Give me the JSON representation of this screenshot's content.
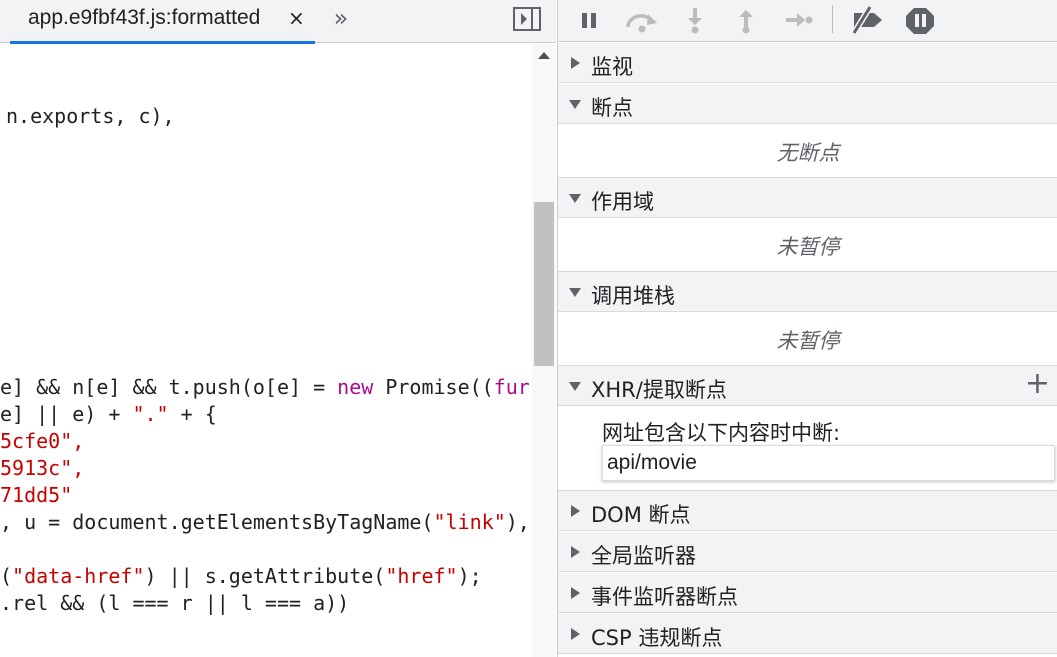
{
  "editor": {
    "tab_label": "app.e9fbf43f.js:formatted",
    "tab_close": "×",
    "more_tabs": "»",
    "code_lines": [
      [
        {
          "t": "n.exports, c),",
          "c": "plain"
        }
      ],
      [
        {
          "t": "e] && n[e] && t.push(o[e] = ",
          "c": "plain"
        },
        {
          "t": "new",
          "c": "kw"
        },
        {
          "t": " Promise((",
          "c": "plain"
        },
        {
          "t": "fur",
          "c": "kw"
        }
      ],
      [
        {
          "t": "e] || e) + ",
          "c": "plain"
        },
        {
          "t": "\".\"",
          "c": "str"
        },
        {
          "t": " + {",
          "c": "plain"
        }
      ],
      [
        {
          "t": "5cfe0\",",
          "c": "str"
        }
      ],
      [
        {
          "t": "5913c\",",
          "c": "str"
        }
      ],
      [
        {
          "t": "71dd5\"",
          "c": "str"
        }
      ],
      [
        {
          "t": ", u = document.getElementsByTagName(",
          "c": "plain"
        },
        {
          "t": "\"link\"",
          "c": "str"
        },
        {
          "t": "),",
          "c": "plain"
        }
      ],
      [
        {
          "t": "(",
          "c": "plain"
        },
        {
          "t": "\"data-href\"",
          "c": "str"
        },
        {
          "t": ") || s.getAttribute(",
          "c": "plain"
        },
        {
          "t": "\"href\"",
          "c": "str"
        },
        {
          "t": ");",
          "c": "plain"
        }
      ],
      [
        {
          "t": ".rel && (l === r || l === a))",
          "c": "plain"
        }
      ]
    ]
  },
  "toolbar": {
    "buttons": [
      "pause-icon",
      "step-over-icon",
      "step-into-icon",
      "step-out-icon",
      "step-icon",
      "deactivate-breakpoints-icon",
      "pause-on-exceptions-icon"
    ]
  },
  "sidebar": {
    "watch": "监视",
    "breakpoints": "断点",
    "breakpoints_empty": "无断点",
    "scope": "作用域",
    "scope_empty": "未暂停",
    "call_stack": "调用堆栈",
    "call_stack_empty": "未暂停",
    "xhr": "XHR/提取断点",
    "xhr_add": "+",
    "xhr_prompt": "网址包含以下内容时中断:",
    "xhr_value": "api/movie",
    "dom": "DOM 断点",
    "global": "全局监听器",
    "event": "事件监听器断点",
    "csp": "CSP 违规断点"
  },
  "colors": {
    "accent": "#1a73e8",
    "string": "#c80000",
    "keyword": "#aa0d91"
  }
}
